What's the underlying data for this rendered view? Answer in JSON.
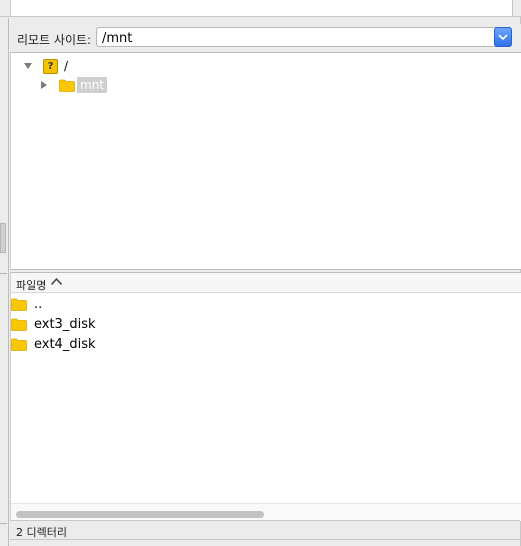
{
  "remote_site": {
    "label": "리모트 사이트:",
    "path": "/mnt"
  },
  "tree": {
    "root": {
      "label": "/",
      "icon": "question-icon",
      "expanded": true
    },
    "children": [
      {
        "label": "mnt",
        "icon": "folder-icon",
        "expanded": false,
        "selected": true
      }
    ]
  },
  "file_list": {
    "column_header": "파일명",
    "sort": "ascending",
    "items": [
      {
        "name": "..",
        "icon": "folder-icon"
      },
      {
        "name": "ext3_disk",
        "icon": "folder-icon"
      },
      {
        "name": "ext4_disk",
        "icon": "folder-icon"
      }
    ]
  },
  "status": {
    "text": "2 디렉터리"
  },
  "colors": {
    "folder": "#f9c800",
    "accent": "#2f6fe6",
    "selection": "#cfcfcf"
  }
}
